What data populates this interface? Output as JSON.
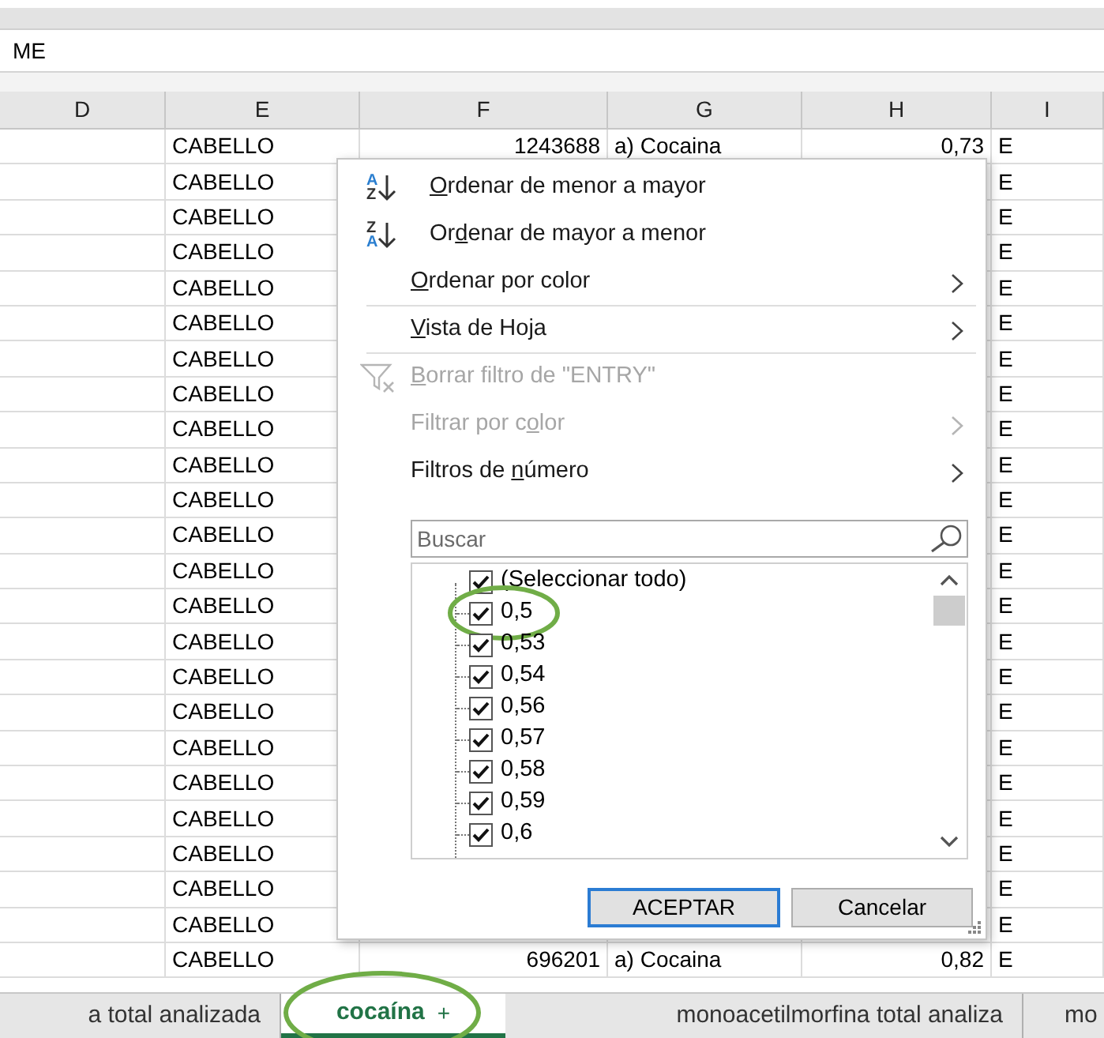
{
  "formula_bar": {
    "text": "ME"
  },
  "columns": [
    "D",
    "E",
    "F",
    "G",
    "H",
    "I"
  ],
  "rows": [
    {
      "column_e": "CABELLO",
      "column_f": "1243688",
      "column_g": "a) Cocaina",
      "column_h": "0,73",
      "column_i": "E"
    },
    {
      "column_e": "CABELLO",
      "column_i": "E"
    },
    {
      "column_e": "CABELLO",
      "column_i": "E"
    },
    {
      "column_e": "CABELLO",
      "column_i": "E"
    },
    {
      "column_e": "CABELLO",
      "column_i": "E"
    },
    {
      "column_e": "CABELLO",
      "column_i": "E"
    },
    {
      "column_e": "CABELLO",
      "column_i": "E"
    },
    {
      "column_e": "CABELLO",
      "column_i": "E"
    },
    {
      "column_e": "CABELLO",
      "column_i": "E"
    },
    {
      "column_e": "CABELLO",
      "column_i": "E"
    },
    {
      "column_e": "CABELLO",
      "column_i": "E"
    },
    {
      "column_e": "CABELLO",
      "column_i": "E"
    },
    {
      "column_e": "CABELLO",
      "column_i": "E"
    },
    {
      "column_e": "CABELLO",
      "column_i": "E"
    },
    {
      "column_e": "CABELLO",
      "column_i": "E"
    },
    {
      "column_e": "CABELLO",
      "column_i": "E"
    },
    {
      "column_e": "CABELLO",
      "column_i": "E"
    },
    {
      "column_e": "CABELLO",
      "column_i": "E"
    },
    {
      "column_e": "CABELLO",
      "column_i": "E"
    },
    {
      "column_e": "CABELLO",
      "column_i": "E"
    },
    {
      "column_e": "CABELLO",
      "column_i": "E"
    },
    {
      "column_e": "CABELLO",
      "column_i": "E"
    },
    {
      "column_e": "CABELLO",
      "column_i": "E"
    },
    {
      "column_e": "CABELLO",
      "column_f": "696201",
      "column_g": "a) Cocaina",
      "column_h": "0,82",
      "column_i": "E"
    }
  ],
  "filter_menu": {
    "items": [
      {
        "kind": "sort",
        "icon_top": "A",
        "icon_bottom": "Z",
        "disabled": false,
        "has_submenu": false,
        "label_parts": [
          {
            "text": "O",
            "underline": true
          },
          {
            "text": "rdenar de menor a mayor",
            "underline": false
          }
        ]
      },
      {
        "kind": "sort",
        "icon_top": "Z",
        "icon_bottom": "A",
        "disabled": false,
        "has_submenu": false,
        "label_parts": [
          {
            "text": "Or",
            "underline": false
          },
          {
            "text": "d",
            "underline": true
          },
          {
            "text": "enar de mayor a menor",
            "underline": false
          }
        ]
      },
      {
        "kind": "command",
        "disabled": false,
        "has_submenu": true,
        "label_parts": [
          {
            "text": "O",
            "underline": true
          },
          {
            "text": "rdenar por color",
            "underline": false
          }
        ]
      },
      {
        "kind": "separator"
      },
      {
        "kind": "command",
        "disabled": false,
        "has_submenu": true,
        "label_parts": [
          {
            "text": "V",
            "underline": true
          },
          {
            "text": "ista de Hoja",
            "underline": false
          }
        ]
      },
      {
        "kind": "separator"
      },
      {
        "kind": "clear_filter",
        "disabled": true,
        "has_submenu": false,
        "label_parts": [
          {
            "text": "B",
            "underline": true
          },
          {
            "text": "orrar filtro de \"ENTRY\"",
            "underline": false
          }
        ]
      },
      {
        "kind": "command",
        "disabled": true,
        "has_submenu": true,
        "label_parts": [
          {
            "text": "Filtrar por c",
            "underline": false
          },
          {
            "text": "o",
            "underline": true
          },
          {
            "text": "lor",
            "underline": false
          }
        ]
      },
      {
        "kind": "command",
        "disabled": false,
        "has_submenu": true,
        "label_parts": [
          {
            "text": "Filtros de ",
            "underline": false
          },
          {
            "text": "n",
            "underline": true
          },
          {
            "text": "úmero",
            "underline": false
          }
        ]
      }
    ],
    "search": {
      "placeholder": "Buscar"
    },
    "values": [
      {
        "label": "(Seleccionar todo)",
        "checked": true,
        "circled": false
      },
      {
        "label": "0,5",
        "checked": true,
        "circled": true
      },
      {
        "label": "0,53",
        "checked": true,
        "circled": false
      },
      {
        "label": "0,54",
        "checked": true,
        "circled": false
      },
      {
        "label": "0,56",
        "checked": true,
        "circled": false
      },
      {
        "label": "0,57",
        "checked": true,
        "circled": false
      },
      {
        "label": "0,58",
        "checked": true,
        "circled": false
      },
      {
        "label": "0,59",
        "checked": true,
        "circled": false
      },
      {
        "label": "0,6",
        "checked": true,
        "circled": false
      }
    ],
    "buttons": [
      {
        "label": "ACEPTAR",
        "default": true
      },
      {
        "label": "Cancelar",
        "default": false
      }
    ]
  },
  "sheet_tabs": [
    {
      "label": "a total analizada",
      "selected": false
    },
    {
      "label": "cocaína",
      "selected": true,
      "add_label": "+",
      "circled": true
    },
    {
      "label": "monoacetilmorfina total analiza",
      "selected": false
    },
    {
      "label": "mo",
      "selected": false
    }
  ]
}
